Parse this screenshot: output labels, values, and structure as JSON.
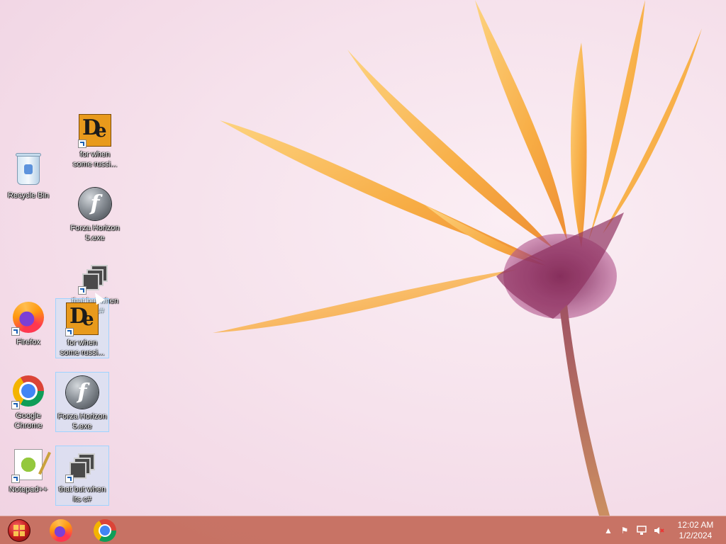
{
  "desktop": {
    "icons": [
      {
        "label": "Recycle Bin",
        "icon": "recycle-bin-icon"
      },
      {
        "label": "for when some russi...",
        "icon": "de-app-icon"
      },
      {
        "label": "Forza Horizon 5.exe",
        "icon": "flash-app-icon"
      },
      {
        "label": "that but when its c#",
        "icon": "stacked-windows-icon"
      },
      {
        "label": "Firefox",
        "icon": "firefox-icon"
      },
      {
        "label": "for when some russi...",
        "icon": "de-app-icon"
      },
      {
        "label": "Google Chrome",
        "icon": "chrome-icon"
      },
      {
        "label": "Forza Horizon 5.exe",
        "icon": "flash-app-icon"
      },
      {
        "label": "Notepad++",
        "icon": "notepad-plus-plus-icon"
      },
      {
        "label": "that but when its c#",
        "icon": "stacked-windows-icon"
      }
    ]
  },
  "taskbar": {
    "pinned": [
      "start-orb-icon",
      "firefox-icon",
      "chrome-icon"
    ],
    "tray": [
      "show-hidden-icons-chevron",
      "action-center-flag-icon",
      "network-icon",
      "volume-muted-icon"
    ],
    "clock": {
      "time": "12:02 AM",
      "date": "1/2/2024"
    }
  },
  "colors": {
    "taskbar": "#c46a5a",
    "petal": "#f5a623",
    "flower_center": "#8a2a5a",
    "selection": "#cce4f7"
  }
}
